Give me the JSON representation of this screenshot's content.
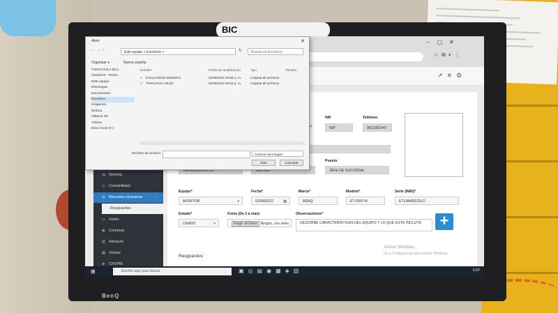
{
  "monitor": {
    "brand": "BenQ",
    "sticker_text": "BIC"
  },
  "dialog": {
    "title": "Abrir",
    "path": "Este equipo > Escritorio >",
    "search_placeholder": "Buscar en Escritorio",
    "organize": "Organizar ▾",
    "new_folder": "Nueva carpeta",
    "nav": [
      "TARACHULA BLV...",
      "OneDrive - Perso...",
      "Este equipo",
      "Descargas",
      "Documentos",
      "Escritorio",
      "Imágenes",
      "Música",
      "Objetos 3D",
      "Vídeos",
      "Disco local (C:)"
    ],
    "nav_selected_index": 5,
    "columns": {
      "name": "Nombre",
      "date": "Fecha de modificación",
      "type": "Tipo",
      "size": "Tamaño"
    },
    "files": [
      {
        "name": "EVALUADOS GENERAL",
        "date": "02/08/2022 09:55 a. m.",
        "type": "Carpeta de archivos"
      },
      {
        "name": "TAPACHULA BLVD",
        "date": "01/08/2022 09:31 p. m.",
        "type": "Carpeta de archivos"
      }
    ],
    "filename_label": "Nombre de archivo:",
    "filetype": "Archivos de imagen",
    "open_button": "Abrir",
    "cancel_button": "Cancelar"
  },
  "sidebar": {
    "items": [
      {
        "label": "Nómina",
        "icon": "▤"
      },
      {
        "label": "Contabilidad",
        "icon": "◎"
      },
      {
        "label": "Recursos Humanos",
        "icon": "▣",
        "active": true
      },
      {
        "label": "Resguardos",
        "sub": true
      },
      {
        "label": "Gasto",
        "icon": "▭"
      },
      {
        "label": "Compras",
        "icon": "◉"
      },
      {
        "label": "Almacén",
        "icon": "▥"
      },
      {
        "label": "Ventas",
        "icon": "▦"
      },
      {
        "label": "CRVPM",
        "icon": "◈"
      }
    ]
  },
  "form": {
    "nip_label": "NIP",
    "nip_value": "NIP",
    "phone_label": "Teléfono",
    "phone_value": "9621952447",
    "puesto_label": "Puesto",
    "sucursal_value": "TAPACHULA BLVD",
    "area_value": "VENTAS",
    "puesto_value": "JEFE DE SUCURSAL",
    "equipo_label": "Equipo*",
    "equipo_value": "MONITOR",
    "fecha_label": "Fecha*",
    "fecha_value": "02/08/2022",
    "marca_label": "Marca*",
    "marca_value": "BENQ",
    "modelo_label": "Modelo*",
    "modelo_value": "ET-0007-B",
    "serie_label": "Serie (IMEI)*",
    "serie_value": "ETL9M09225LD",
    "estado_label": "Estado*",
    "estado_value": "USADO",
    "fotos_label": "Fotos (De 2 a mas)",
    "choose_files_button": "Elegir archivos",
    "no_file_text": "Ningún...los selec",
    "obs_label": "Observaciones*",
    "obs_value": "DESCRIBE CARACTERISTICAS DEL EQUIPO Y LO QUE ESTE INCLUYE",
    "add_button": "+",
    "section_title": "Resguardos"
  },
  "watermark": {
    "line1": "Activar Windows",
    "line2": "Ve a Configuración para activar Windows."
  },
  "taskbar": {
    "search_placeholder": "Escribe aquí para buscar",
    "tray": "ESP"
  },
  "colors": {
    "accent": "#2f7cc1",
    "sidebar": "#2e3239",
    "wall": "#e7b21c"
  }
}
